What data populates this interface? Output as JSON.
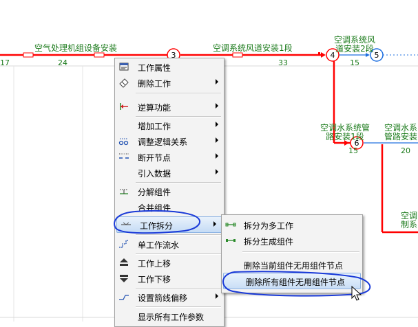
{
  "network": {
    "nodes": [
      {
        "id": "3",
        "label": "3"
      },
      {
        "id": "4",
        "label": "4"
      },
      {
        "id": "5",
        "label": "5"
      },
      {
        "id": "6",
        "label": "6"
      }
    ],
    "activities": [
      {
        "name": "空气处理机组设备安装",
        "duration": "24"
      },
      {
        "name": "空调系统风道安装1段",
        "duration": "33"
      },
      {
        "name_line1": "空调系统风",
        "name_line2": "道安装2段",
        "duration": "15"
      },
      {
        "name_line1": "空调水系统管",
        "name_line2": "路安装1段",
        "duration": "15"
      },
      {
        "name_line1": "空调水系",
        "name_line2": "管路安装",
        "duration": "20"
      },
      {
        "name_line1": "空调",
        "name_line2": "制系"
      }
    ],
    "left_duration": "17",
    "colors": {
      "critical": "#ff0000",
      "label": "#1a7a1a",
      "node_blue": "#1e6fe0"
    }
  },
  "context_menu": {
    "items": [
      {
        "label": "工作属性",
        "icon": "properties-icon",
        "submenu": false
      },
      {
        "label": "删除工作",
        "icon": "eraser-icon",
        "submenu": true
      },
      {
        "label": "逆算功能",
        "icon": "reverse-calc-icon",
        "submenu": true
      },
      {
        "label": "增加工作",
        "icon": "",
        "submenu": true
      },
      {
        "label": "调整逻辑关系",
        "icon": "logic-relation-icon",
        "submenu": true
      },
      {
        "label": "断开节点",
        "icon": "break-node-icon",
        "submenu": true
      },
      {
        "label": "引入数据",
        "icon": "",
        "submenu": true
      },
      {
        "label": "分解组件",
        "icon": "decompose-icon",
        "submenu": false
      },
      {
        "label": "合并组件",
        "icon": "",
        "submenu": false
      },
      {
        "label": "工作拆分",
        "icon": "split-icon",
        "submenu": true
      },
      {
        "label": "单工作流水",
        "icon": "flow-icon",
        "submenu": false
      },
      {
        "label": "工作上移",
        "icon": "move-up-icon",
        "submenu": false
      },
      {
        "label": "工作下移",
        "icon": "move-down-icon",
        "submenu": false
      },
      {
        "label": "设置箭线偏移",
        "icon": "arrow-offset-icon",
        "submenu": true
      },
      {
        "label": "显示所有工作参数",
        "icon": "",
        "submenu": false
      }
    ]
  },
  "submenu": {
    "items": [
      {
        "label": "拆分为多工作",
        "icon": "split-multi-icon"
      },
      {
        "label": "拆分生成组件",
        "icon": "split-component-icon"
      },
      {
        "label": "删除当前组件无用组件节点",
        "icon": ""
      },
      {
        "label": "删除所有组件无用组件节点",
        "icon": ""
      }
    ]
  }
}
